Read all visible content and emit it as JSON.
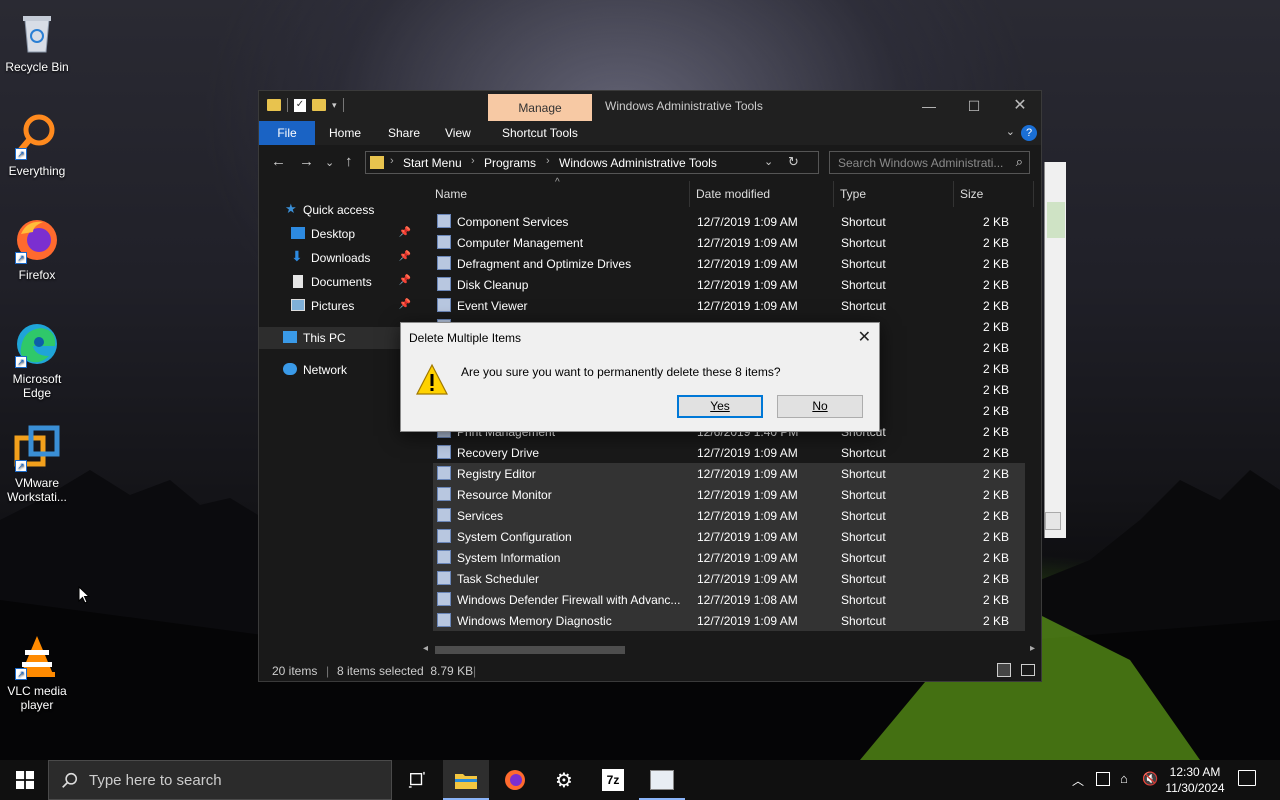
{
  "desktop": {
    "icons": [
      {
        "label": "Recycle Bin"
      },
      {
        "label": "Everything"
      },
      {
        "label": "Firefox"
      },
      {
        "label": "Microsoft Edge"
      },
      {
        "label": "VMware Workstati..."
      },
      {
        "label": "VLC media player"
      }
    ]
  },
  "explorer": {
    "context_tab": "Manage",
    "title": "Windows Administrative Tools",
    "ribbon_tabs": [
      "File",
      "Home",
      "Share",
      "View",
      "Shortcut Tools"
    ],
    "breadcrumb": [
      "Start Menu",
      "Programs",
      "Windows Administrative Tools"
    ],
    "search_placeholder": "Search Windows Administrati...",
    "nav": {
      "quick_access": "Quick access",
      "items": [
        "Desktop",
        "Downloads",
        "Documents",
        "Pictures"
      ],
      "this_pc": "This PC",
      "network": "Network"
    },
    "columns": {
      "name": "Name",
      "date": "Date modified",
      "type": "Type",
      "size": "Size"
    },
    "files": [
      {
        "name": "Component Services",
        "date": "12/7/2019 1:09 AM",
        "type": "Shortcut",
        "size": "2 KB",
        "selected": false
      },
      {
        "name": "Computer Management",
        "date": "12/7/2019 1:09 AM",
        "type": "Shortcut",
        "size": "2 KB",
        "selected": false
      },
      {
        "name": "Defragment and Optimize Drives",
        "date": "12/7/2019 1:09 AM",
        "type": "Shortcut",
        "size": "2 KB",
        "selected": false
      },
      {
        "name": "Disk Cleanup",
        "date": "12/7/2019 1:09 AM",
        "type": "Shortcut",
        "size": "2 KB",
        "selected": false
      },
      {
        "name": "Event Viewer",
        "date": "12/7/2019 1:09 AM",
        "type": "Shortcut",
        "size": "2 KB",
        "selected": false
      },
      {
        "name": "",
        "date": "",
        "type": "t",
        "size": "2 KB",
        "selected": false
      },
      {
        "name": "",
        "date": "",
        "type": "t",
        "size": "2 KB",
        "selected": false
      },
      {
        "name": "",
        "date": "",
        "type": "t",
        "size": "2 KB",
        "selected": false
      },
      {
        "name": "",
        "date": "",
        "type": "t",
        "size": "2 KB",
        "selected": false
      },
      {
        "name": "",
        "date": "",
        "type": "t",
        "size": "2 KB",
        "selected": false
      },
      {
        "name": "Print Management",
        "date": "12/6/2019 1:40 PM",
        "type": "Shortcut",
        "size": "2 KB",
        "selected": false
      },
      {
        "name": "Recovery Drive",
        "date": "12/7/2019 1:09 AM",
        "type": "Shortcut",
        "size": "2 KB",
        "selected": false
      },
      {
        "name": "Registry Editor",
        "date": "12/7/2019 1:09 AM",
        "type": "Shortcut",
        "size": "2 KB",
        "selected": true
      },
      {
        "name": "Resource Monitor",
        "date": "12/7/2019 1:09 AM",
        "type": "Shortcut",
        "size": "2 KB",
        "selected": true
      },
      {
        "name": "Services",
        "date": "12/7/2019 1:09 AM",
        "type": "Shortcut",
        "size": "2 KB",
        "selected": true
      },
      {
        "name": "System Configuration",
        "date": "12/7/2019 1:09 AM",
        "type": "Shortcut",
        "size": "2 KB",
        "selected": true
      },
      {
        "name": "System Information",
        "date": "12/7/2019 1:09 AM",
        "type": "Shortcut",
        "size": "2 KB",
        "selected": true
      },
      {
        "name": "Task Scheduler",
        "date": "12/7/2019 1:09 AM",
        "type": "Shortcut",
        "size": "2 KB",
        "selected": true
      },
      {
        "name": "Windows Defender Firewall with Advanc...",
        "date": "12/7/2019 1:08 AM",
        "type": "Shortcut",
        "size": "2 KB",
        "selected": true
      },
      {
        "name": "Windows Memory Diagnostic",
        "date": "12/7/2019 1:09 AM",
        "type": "Shortcut",
        "size": "2 KB",
        "selected": true
      }
    ],
    "status": {
      "count": "20 items",
      "selection": "8 items selected  8.79 KB"
    }
  },
  "dialog": {
    "title": "Delete Multiple Items",
    "message": "Are you sure you want to permanently delete these 8 items?",
    "yes": "Yes",
    "no": "No"
  },
  "taskbar": {
    "search_placeholder": "Type here to search",
    "time": "12:30 AM",
    "date": "11/30/2024"
  }
}
